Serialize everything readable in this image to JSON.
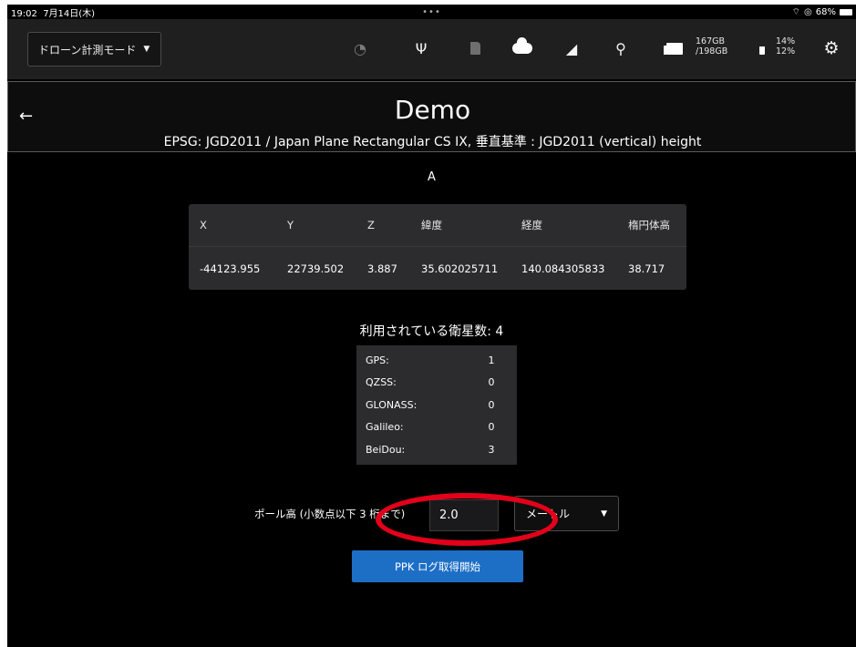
{
  "status_bar": {
    "time": "19:02",
    "date": "7月14日(木)",
    "dots": "•••",
    "battery": "68%"
  },
  "toolbar": {
    "mode_label": "ドローン計測モード",
    "storage_used": "167GB",
    "storage_total": "/198GB",
    "battery_1": "14%",
    "battery_2": "12%"
  },
  "header": {
    "title": "Demo",
    "subtitle": "EPSG: JGD2011 / Japan Plane Rectangular CS IX, 垂直基準 : JGD2011 (vertical) height"
  },
  "point": {
    "name": "A"
  },
  "coordinates": {
    "headers": [
      "X",
      "Y",
      "Z",
      "緯度",
      "経度",
      "楕円体高"
    ],
    "values": [
      "-44123.955",
      "22739.502",
      "3.887",
      "35.602025711",
      "140.084305833",
      "38.717"
    ]
  },
  "satellites": {
    "title": "利用されている衛星数: 4",
    "rows": [
      {
        "name": "GPS:",
        "count": "1"
      },
      {
        "name": "QZSS:",
        "count": "0"
      },
      {
        "name": "GLONASS:",
        "count": "0"
      },
      {
        "name": "Galileo:",
        "count": "0"
      },
      {
        "name": "BeiDou:",
        "count": "3"
      }
    ]
  },
  "pole": {
    "label": "ポール高 (小数点以下 3 桁まで)",
    "value": "2.0",
    "unit": "メートル"
  },
  "actions": {
    "ppk_button": "PPK ログ取得開始"
  },
  "colors": {
    "accent": "#1d6fc6",
    "annotation": "#e4001a",
    "toolbar_bg": "#1f1f1f",
    "panel_bg": "#2c2c2e"
  }
}
